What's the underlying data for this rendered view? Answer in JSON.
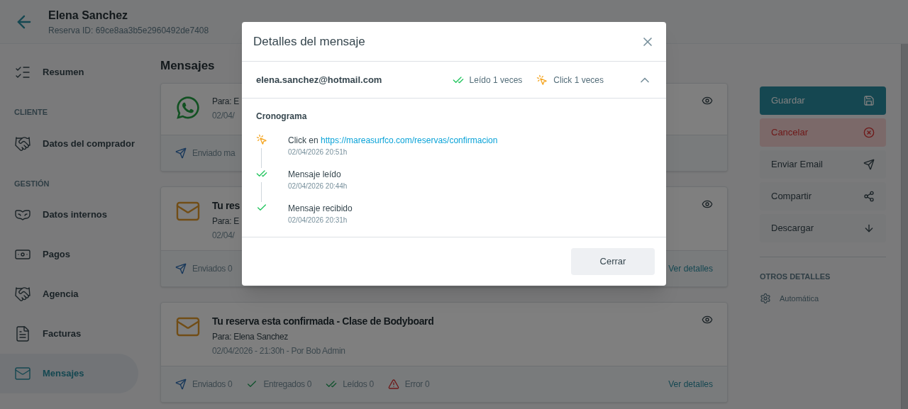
{
  "header": {
    "title": "Elena Sanchez",
    "subtitle": "Reserva ID: 69ce8aa3b5e2960492de7408"
  },
  "sidebar": {
    "sections": [
      {
        "items": [
          {
            "label": "Resumen",
            "selected": false
          }
        ]
      },
      {
        "title": "CLIENTE",
        "items": [
          {
            "label": "Datos del comprador",
            "selected": false
          }
        ]
      },
      {
        "title": "GESTIÓN",
        "items": [
          {
            "label": "Datos internos",
            "selected": false
          },
          {
            "label": "Pagos",
            "selected": false
          },
          {
            "label": "Agencia",
            "selected": false
          },
          {
            "label": "Facturas",
            "selected": false
          },
          {
            "label": "Mensajes",
            "selected": true
          }
        ]
      }
    ]
  },
  "main": {
    "title": "Mensajes",
    "messages": [
      {
        "kind": "whatsapp",
        "to": "Para: E",
        "meta": "02/04/",
        "stats": [
          {
            "kind": "sent",
            "label": "Enviado ma"
          }
        ]
      },
      {
        "kind": "email",
        "title": "Tu res",
        "to": "Para: E",
        "meta": "02/04/",
        "stats": [
          {
            "kind": "sent",
            "label": "Enviados 0"
          }
        ],
        "link": "Ver detalles"
      },
      {
        "kind": "email",
        "title": "Tu reserva esta confirmada - Clase de Bodyboard",
        "to": "Para: Elena Sanchez",
        "meta": "02/04/2026 - 21:30h - Por Bob Admin",
        "stats": [
          {
            "kind": "sent",
            "label": "Enviados 0"
          },
          {
            "kind": "delivered",
            "label": "Entregados 0"
          },
          {
            "kind": "read",
            "label": "Leídos 0"
          },
          {
            "kind": "error",
            "label": "Error 0"
          }
        ],
        "link": "Ver detalles"
      }
    ]
  },
  "actions": [
    {
      "kind": "primary",
      "label": "Guardar"
    },
    {
      "kind": "danger",
      "label": "Cancelar"
    },
    {
      "kind": "send",
      "label": "Enviar Email"
    },
    {
      "kind": "share",
      "label": "Compartir"
    },
    {
      "kind": "download",
      "label": "Descargar"
    }
  ],
  "other_details": {
    "title": "OTROS DETALLES",
    "items": [
      {
        "label": "Automática"
      }
    ]
  },
  "modal": {
    "title": "Detalles del mensaje",
    "recipient": "elena.sanchez@hotmail.com",
    "read_count": "Leído 1 veces",
    "click_count": "Click 1 veces",
    "expanded": true,
    "timeline_title": "Cronograma",
    "events": [
      {
        "kind": "click",
        "text": "Click en",
        "link": "https://mareasurfco.com/reservas/confirmacion",
        "time": "02/04/2026 20:51h"
      },
      {
        "kind": "read",
        "text": "Mensaje leído",
        "time": "02/04/2026 20:44h"
      },
      {
        "kind": "received",
        "text": "Mensaje recibido",
        "time": "02/04/2026 20:31h"
      }
    ],
    "close_button": "Cerrar"
  }
}
